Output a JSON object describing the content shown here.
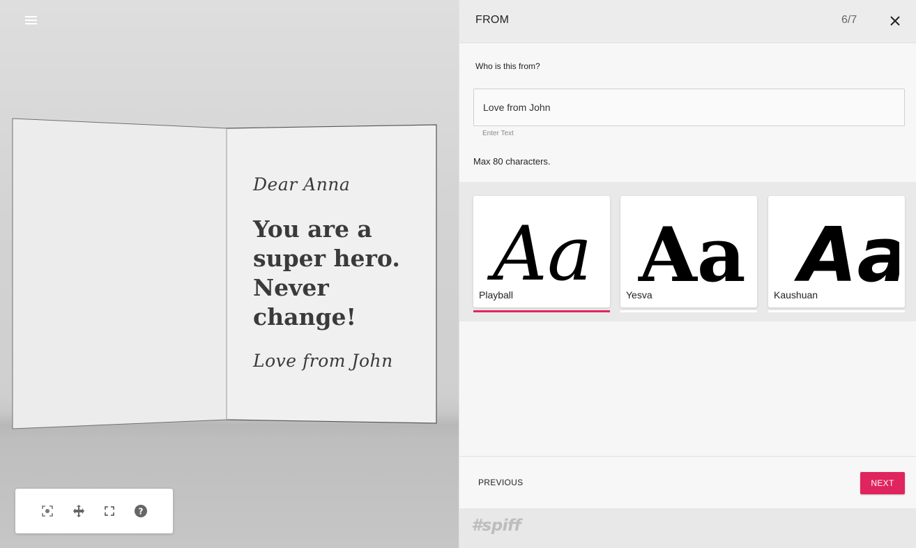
{
  "preview": {
    "card": {
      "salutation": "Dear Anna",
      "message": "You are a super hero. Never change!",
      "signoff": "Love from John"
    },
    "toolbar": [
      {
        "icon": "focus-icon"
      },
      {
        "icon": "move-icon"
      },
      {
        "icon": "fullscreen-icon"
      },
      {
        "icon": "help-icon"
      }
    ]
  },
  "panel": {
    "title": "FROM",
    "step": "6/7",
    "question": "Who is this from?",
    "input_value": "Love from John",
    "input_hint": "Enter Text",
    "max_chars": "Max 80 characters.",
    "fonts": [
      {
        "name": "Playball",
        "sample": "Aa",
        "selected": true
      },
      {
        "name": "Yesva",
        "sample": "Aa",
        "selected": false
      },
      {
        "name": "Kaushuan",
        "sample": "Aa",
        "selected": false
      }
    ],
    "previous_label": "PREVIOUS",
    "next_label": "NEXT",
    "brand": "#spiff"
  },
  "colors": {
    "accent": "#e0245e",
    "panel_bg": "#f6f6f6"
  }
}
